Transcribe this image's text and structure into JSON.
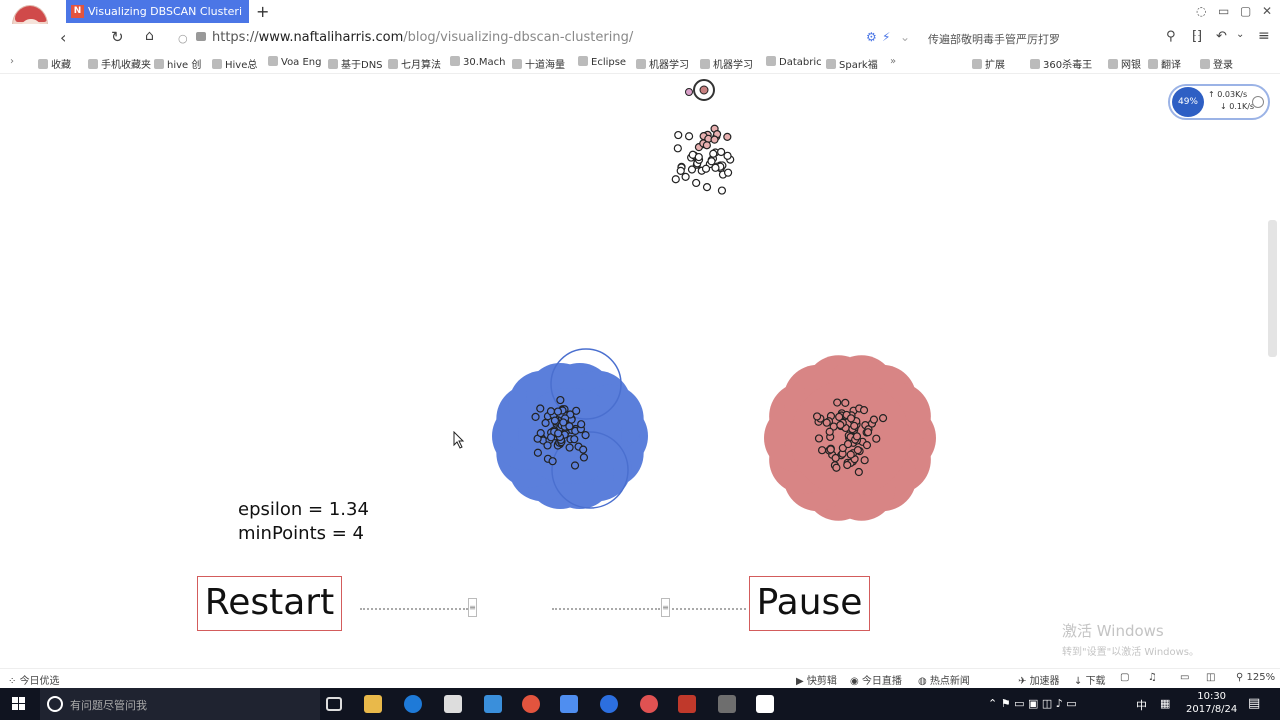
{
  "browser": {
    "tab_title": "Visualizing DBSCAN Clusteri",
    "tab_favicon": "N",
    "new_tab": "+",
    "url_protocol": "https://",
    "url_host": "www.naftaliharris.com",
    "url_path": "/blog/visualizing-dbscan-clustering/",
    "promo_text": "传遍部敬明毒手管严厉打罗",
    "bookmarks": [
      "收藏",
      "手机收藏夹",
      "hive 创",
      "Hive总",
      "Voa Eng",
      "基于DNS",
      "七月算法",
      "30.Mach",
      "十道海量",
      "Eclipse",
      "机器学习",
      "机器学习",
      "Databric",
      "Spark福"
    ],
    "bookmarks_right": [
      "扩展",
      "360杀毒王",
      "网银",
      "翻译",
      "登录"
    ],
    "speed": {
      "percent": "49%",
      "upload": "0.03K/s",
      "download": "0.1K/s"
    }
  },
  "page": {
    "epsilon_label": "epsilon = 1.34",
    "minpoints_label": "minPoints = 4",
    "restart_label": "Restart",
    "pause_label": "Pause",
    "slider_handle": "≡",
    "colors": {
      "cluster_blue": "#5b7fdb",
      "cluster_pink": "#d88585",
      "point_stroke": "#222222",
      "button_border": "#d35c5c"
    }
  },
  "watermark": {
    "title": "激活 Windows",
    "subtitle": "转到\"设置\"以激活 Windows。"
  },
  "statusbar": {
    "left": "今日优选",
    "items": [
      "快剪辑",
      "今日直播",
      "热点新闻",
      "加速器",
      "下载"
    ],
    "zoom": "125%"
  },
  "taskbar": {
    "search_placeholder": "有问题尽管问我",
    "ime": "中",
    "time": "10:30",
    "date": "2017/8/24"
  }
}
